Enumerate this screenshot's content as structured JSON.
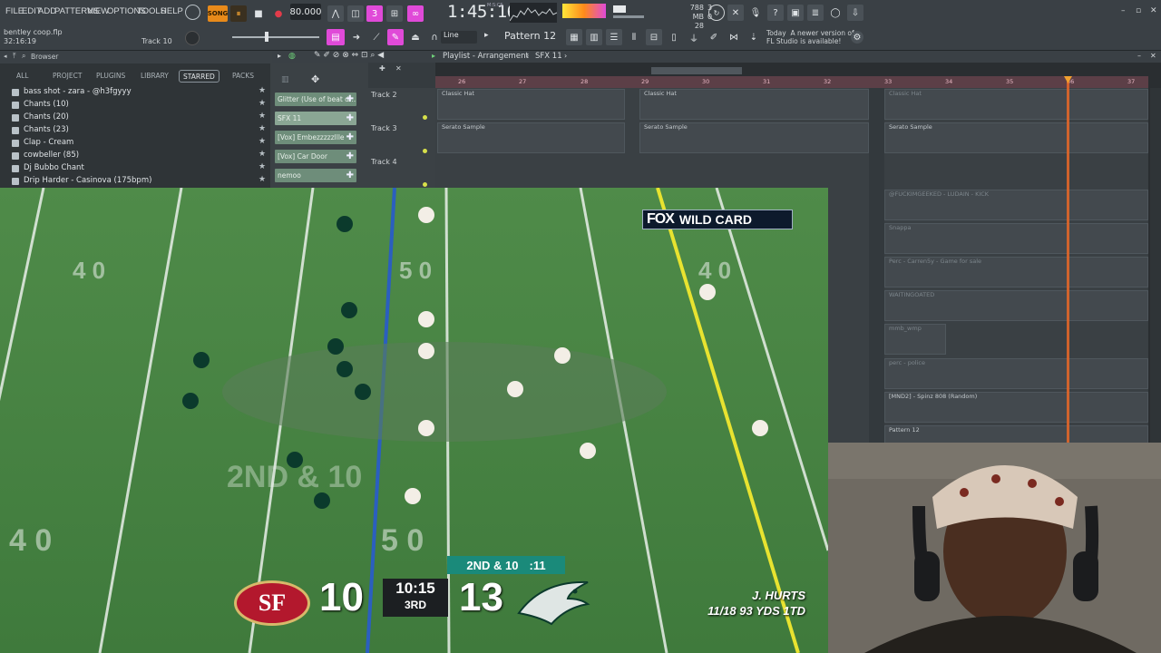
{
  "menu": [
    "FILE",
    "EDIT",
    "ADD",
    "PATTERNS",
    "VIEW",
    "OPTIONS",
    "TOOLS",
    "HELP"
  ],
  "transport": {
    "mode": "SONG",
    "tempo": "80.000",
    "time": "1:45:16",
    "time_unit": "M:S:CS"
  },
  "status": {
    "memory_value": "788 MB",
    "memory_sub": "28",
    "voices": "3",
    "voices_sub": "0"
  },
  "project": {
    "file": "bentley coop.flp",
    "length": "32:16:19"
  },
  "hint_track": "Track 10",
  "snap": "Line",
  "pattern": "Pattern 12",
  "news": {
    "line1": "Today",
    "line2": "A newer version of",
    "line3": "FL Studio is available!"
  },
  "browser": {
    "title": "Browser",
    "tabs": [
      "ALL",
      "PROJECT",
      "PLUGINS",
      "LIBRARY",
      "STARRED",
      "PACKS"
    ],
    "active_tab": "STARRED",
    "items": [
      "bass shot - zara - @h3fgyyy",
      "Chants (10)",
      "Chants (20)",
      "Chants (23)",
      "Clap - Cream",
      "cowbeller (85)",
      "Dj Bubbo Chant",
      "Drip Harder - Casinova (175bpm)"
    ]
  },
  "picker": [
    "Glitter (Use of beat d...",
    "SFX 11",
    "[Vox] Embezzzzzllle",
    "[Vox] Car Door",
    "nemoo"
  ],
  "playlist": {
    "title": "Playlist - Arrangement",
    "current": "SFX 11",
    "timeline": [
      "26",
      "27",
      "28",
      "29",
      "30",
      "31",
      "32",
      "33",
      "34",
      "35",
      "36",
      "37"
    ],
    "tracks": [
      "Track 2",
      "Track 3",
      "Track 4"
    ],
    "clips": [
      "Classic Hat",
      "Classic Hat",
      "Classic Hat",
      "Serato Sample",
      "Serato Sample",
      "Serato Sample",
      "@FUCKIMGEEKED - LUDAIN - KICK",
      "Snappa",
      "Perc - Carren5y - Game for sale",
      "WAITINGOATED",
      "mmb_wmp",
      "perc - police",
      "[MND2] - Spinz 808 (Random)",
      "Pattern 12"
    ]
  },
  "broadcast": {
    "network_badge": "WILD CARD",
    "network_brand": "FOX",
    "away_abbr": "SF",
    "away_score": "10",
    "home_score": "13",
    "clock": "10:15",
    "quarter": "3RD",
    "down": "2ND & 10",
    "play_clock": ":11",
    "player_name": "J. HURTS",
    "player_stats": "11/18 93 YDS 1TD"
  },
  "colors": {
    "accent_pink": "#e04ad8",
    "playhead": "#e0662a",
    "timeline": "#5c3f47",
    "picker_green": "#6e8d7a"
  }
}
